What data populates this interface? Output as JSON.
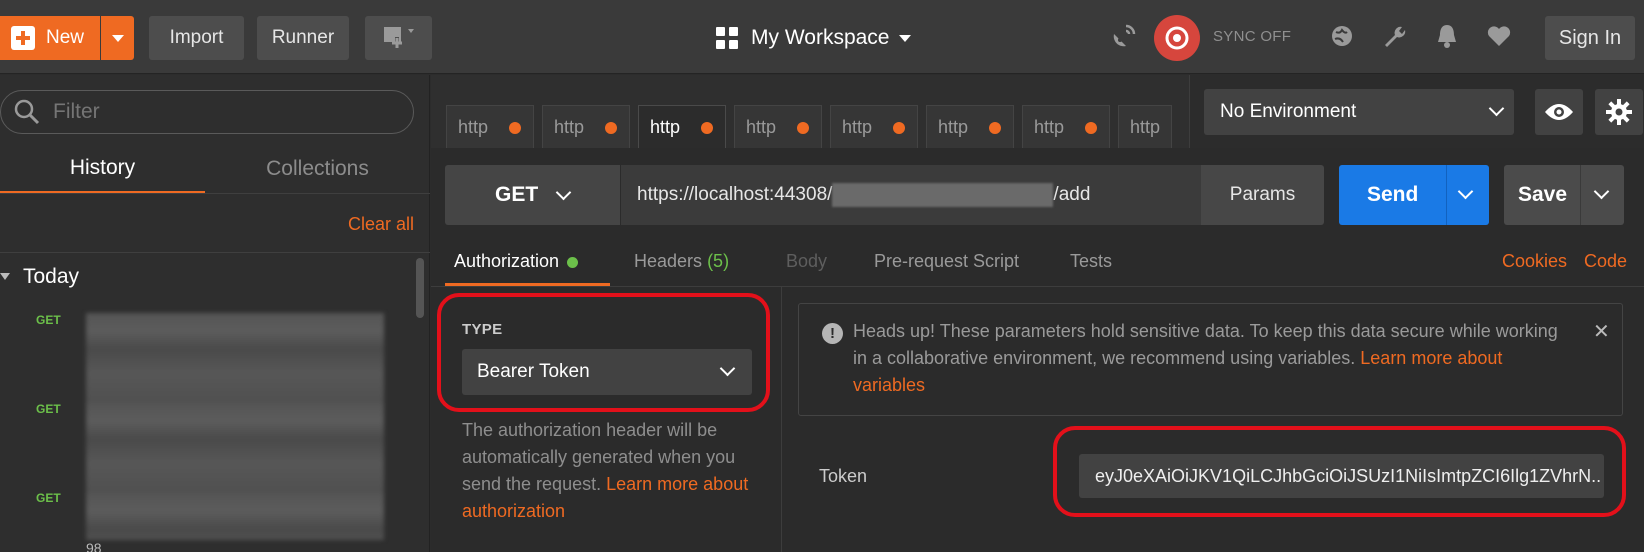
{
  "topbar": {
    "new_label": "New",
    "import_label": "Import",
    "runner_label": "Runner",
    "workspace_label": "My Workspace",
    "sync_label": "SYNC OFF",
    "signin_label": "Sign In"
  },
  "sidebar": {
    "filter_placeholder": "Filter",
    "tabs": [
      "History",
      "Collections"
    ],
    "clear_all": "Clear all",
    "group_label": "Today",
    "history_methods": [
      "GET",
      "GET",
      "GET"
    ],
    "history_tail": "98"
  },
  "request_tabs": [
    {
      "label": "http",
      "dirty": true
    },
    {
      "label": "http",
      "dirty": true
    },
    {
      "label": "http",
      "dirty": true,
      "active": true
    },
    {
      "label": "http",
      "dirty": true
    },
    {
      "label": "http",
      "dirty": true
    },
    {
      "label": "http",
      "dirty": true
    },
    {
      "label": "http",
      "dirty": true
    },
    {
      "label": "http",
      "dirty": false
    }
  ],
  "environment": {
    "selected": "No Environment"
  },
  "request": {
    "method": "GET",
    "url_prefix": "https://localhost:44308/",
    "url_suffix": "/add",
    "params_label": "Params",
    "send_label": "Send",
    "save_label": "Save"
  },
  "subtabs": {
    "authorization": "Authorization",
    "headers": "Headers",
    "headers_count": "(5)",
    "body": "Body",
    "prerequest": "Pre-request Script",
    "tests": "Tests",
    "cookies": "Cookies",
    "code": "Code"
  },
  "auth": {
    "type_label": "TYPE",
    "type_value": "Bearer Token",
    "description": "The authorization header will be automatically generated when you send the request.",
    "description_link": "Learn more about authorization",
    "headsup_text": "Heads up! These parameters hold sensitive data. To keep this data secure while working in a collaborative environment, we recommend using variables.",
    "headsup_link": "Learn more about variables",
    "token_label": "Token",
    "token_value": "eyJ0eXAiOiJKV1QiLCJhbGciOiJSUzI1NiIsImtpZCI6Ilg1ZVhrN.."
  },
  "colors": {
    "accent": "#ef6a22",
    "send": "#1a7ae6",
    "get_method": "#6cc04a",
    "highlight": "#e3101a"
  }
}
